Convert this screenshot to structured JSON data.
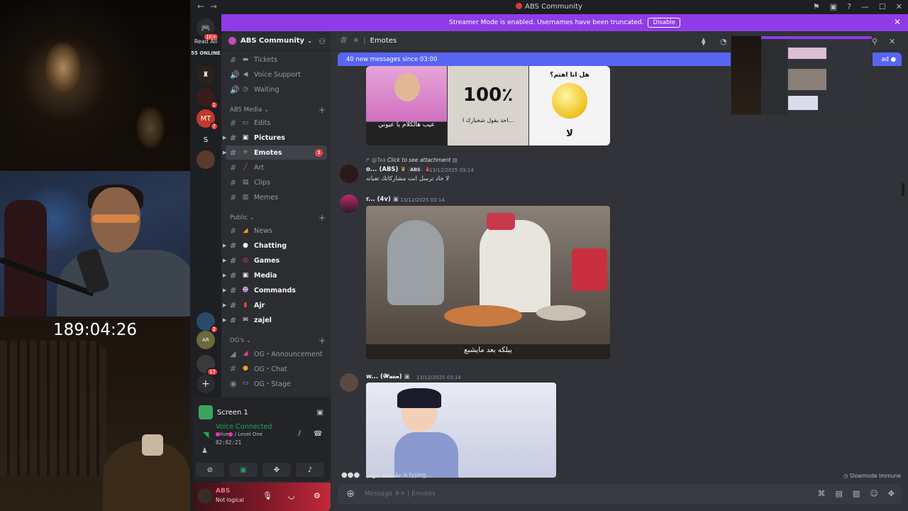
{
  "overlay": {
    "timer": "189:04:26"
  },
  "window": {
    "title": "ABS Community"
  },
  "banner": {
    "text": "Streamer Mode is enabled. Usernames have been truncated.",
    "disable_label": "Disable"
  },
  "rail": {
    "read_all": "Read All",
    "online": "55 ONLINE",
    "items": [
      {
        "label": "",
        "badge": "1"
      },
      {
        "label": "MT",
        "badge": "7"
      },
      {
        "label": "S",
        "badge": ""
      },
      {
        "label": "AR",
        "badge": ""
      },
      {
        "label": "",
        "badge": "17"
      },
      {
        "label": "",
        "badge": "2"
      }
    ],
    "notif_badge": "1K+"
  },
  "server": {
    "name": "ABS Community"
  },
  "channels_top": [
    {
      "name": "Tickets",
      "type": "text",
      "icon": "ticket-icon"
    },
    {
      "name": "Voice Support",
      "type": "voice",
      "icon": "speaker-icon"
    },
    {
      "name": "Waiting",
      "type": "voice",
      "icon": "clock-icon"
    }
  ],
  "categories": {
    "media": "ABS Media",
    "public": "Public",
    "ogs": "OG's"
  },
  "channels_media": [
    {
      "name": "Edits",
      "bold": false
    },
    {
      "name": "Pictures",
      "bold": true
    },
    {
      "name": "Emotes",
      "bold": true,
      "active": true,
      "badge": "1"
    },
    {
      "name": "Art",
      "bold": false
    },
    {
      "name": "Clips",
      "bold": false
    },
    {
      "name": "Memes",
      "bold": false
    }
  ],
  "channels_public": [
    {
      "name": "News",
      "bold": false
    },
    {
      "name": "Chatting",
      "bold": true
    },
    {
      "name": "Games",
      "bold": true
    },
    {
      "name": "Media",
      "bold": true
    },
    {
      "name": "Commands",
      "bold": true
    },
    {
      "name": "Ajr",
      "bold": true
    },
    {
      "name": "zajel",
      "bold": true
    }
  ],
  "channels_ogs": [
    {
      "name": "OG・Announcement"
    },
    {
      "name": "OG・Chat"
    },
    {
      "name": "OG・Stage"
    }
  ],
  "voice": {
    "share_label": "Screen 1",
    "status": "Voice Connected",
    "channel_prefix": "live",
    "channel": "/ Level One",
    "elapsed": "02:02:21"
  },
  "user": {
    "name": "ABS",
    "status": "Not logical"
  },
  "chat": {
    "channel": "Emotes",
    "new_messages": "40 new messages since 03:00",
    "mark_read": "ad",
    "meme_captions": [
      "عيب هالكلام يا عيوني",
      "100٪",
      "احد يقول شخبارك ا...",
      "هل انا اهتم؟",
      "لا"
    ],
    "reply": {
      "to": "@Taa",
      "text": "Click to see attachment"
    },
    "messages": [
      {
        "name": "o... (ABS)",
        "tag": "ABS",
        "time": "13/12/2025 03:14",
        "text": "لا حاد ترسل انت مشاركاتك تعبانه"
      },
      {
        "name": "r... (4v)",
        "time": "13/12/2025 03:14",
        "caption": "يبلكه بعد مايشبع"
      },
      {
        "name": "w... (𝓦𝓪𝓼𝓷)",
        "time": "13/12/2025 03:14"
      }
    ],
    "typing_user": "جلجليله جولي",
    "typing_suffix": "is typing...",
    "slowmode": "Slowmode Immune",
    "composer_placeholder": "Message #✳ | Emotes"
  }
}
